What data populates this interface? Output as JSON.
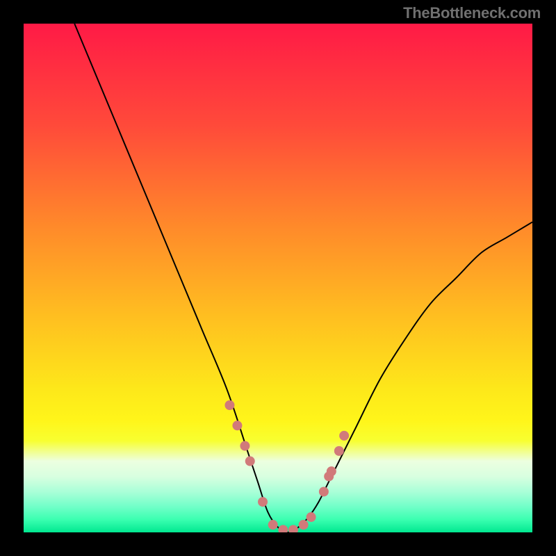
{
  "watermark": "TheBottleneck.com",
  "chart_data": {
    "type": "line",
    "title": "",
    "xlabel": "",
    "ylabel": "",
    "x_range": [
      0,
      100
    ],
    "y_range": [
      0,
      100
    ],
    "curve": {
      "name": "bottleneck-curve",
      "color": "#000000",
      "x": [
        10,
        15,
        20,
        25,
        30,
        35,
        40,
        44,
        46,
        48,
        50,
        52,
        54,
        56,
        58,
        60,
        65,
        70,
        75,
        80,
        85,
        90,
        95,
        100
      ],
      "y": [
        100,
        88,
        76,
        64,
        52,
        40,
        28,
        16,
        10,
        4,
        1,
        0,
        1,
        3,
        6,
        10,
        20,
        30,
        38,
        45,
        50,
        55,
        58,
        61
      ]
    },
    "markers": {
      "name": "highlight-points",
      "color": "#d17a7a",
      "radius": 7,
      "x": [
        40.5,
        42,
        43.5,
        44.5,
        47,
        49,
        51,
        53,
        55,
        56.5,
        59,
        60,
        60.5,
        62,
        63
      ],
      "y": [
        25,
        21,
        17,
        14,
        6,
        1.5,
        0.5,
        0.5,
        1.5,
        3,
        8,
        11,
        12,
        16,
        19
      ]
    },
    "background_gradient": {
      "type": "vertical",
      "stops": [
        {
          "offset": 0.0,
          "color": "#ff1a46"
        },
        {
          "offset": 0.2,
          "color": "#ff4a3a"
        },
        {
          "offset": 0.4,
          "color": "#ff8a2a"
        },
        {
          "offset": 0.58,
          "color": "#ffc020"
        },
        {
          "offset": 0.72,
          "color": "#fde81a"
        },
        {
          "offset": 0.78,
          "color": "#fff51a"
        },
        {
          "offset": 0.82,
          "color": "#f8ff30"
        },
        {
          "offset": 0.86,
          "color": "#ecffe0"
        },
        {
          "offset": 0.89,
          "color": "#d8ffe0"
        },
        {
          "offset": 0.92,
          "color": "#aaffd8"
        },
        {
          "offset": 0.95,
          "color": "#70ffc8"
        },
        {
          "offset": 0.975,
          "color": "#3affb0"
        },
        {
          "offset": 1.0,
          "color": "#00e890"
        }
      ]
    }
  }
}
